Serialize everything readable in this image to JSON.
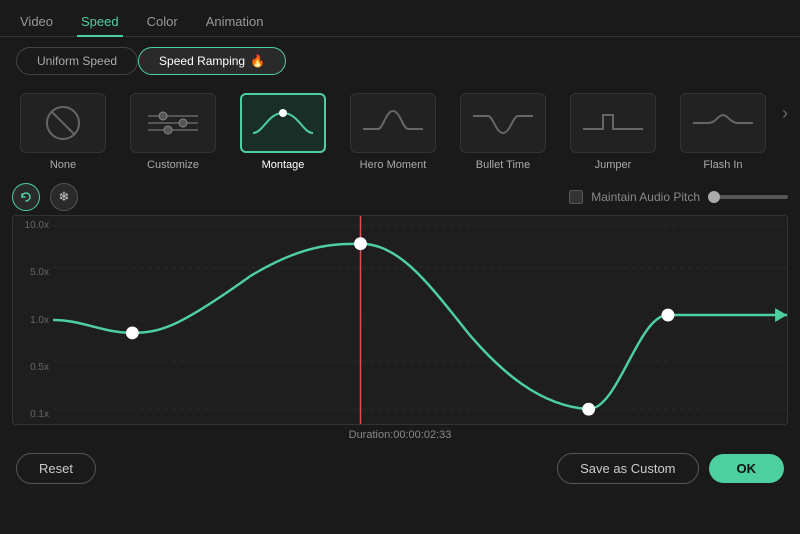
{
  "topTabs": {
    "items": [
      {
        "label": "Video",
        "active": false
      },
      {
        "label": "Speed",
        "active": true
      },
      {
        "label": "Color",
        "active": false
      },
      {
        "label": "Animation",
        "active": false
      }
    ]
  },
  "modeSwitcher": {
    "uniform": "Uniform Speed",
    "ramping": "Speed Ramping",
    "fireIcon": "🔥"
  },
  "presets": [
    {
      "id": "none",
      "label": "None",
      "selected": false
    },
    {
      "id": "customize",
      "label": "Customize",
      "selected": false
    },
    {
      "id": "montage",
      "label": "Montage",
      "selected": true
    },
    {
      "id": "hero-moment",
      "label": "Hero Moment",
      "selected": false
    },
    {
      "id": "bullet-time",
      "label": "Bullet Time",
      "selected": false
    },
    {
      "id": "jumper",
      "label": "Jumper",
      "selected": false
    },
    {
      "id": "flash-in",
      "label": "Flash In",
      "selected": false
    }
  ],
  "controls": {
    "btn1": "⟲",
    "btn2": "❄",
    "audioPitch": "Maintain Audio Pitch"
  },
  "chart": {
    "yLabels": [
      "10.0x",
      "5.0x",
      "1.0x",
      "0.5x",
      "0.1x"
    ],
    "duration": "Duration:00:00:02:33"
  },
  "bottomBar": {
    "resetLabel": "Reset",
    "saveLabel": "Save as Custom",
    "okLabel": "OK"
  }
}
